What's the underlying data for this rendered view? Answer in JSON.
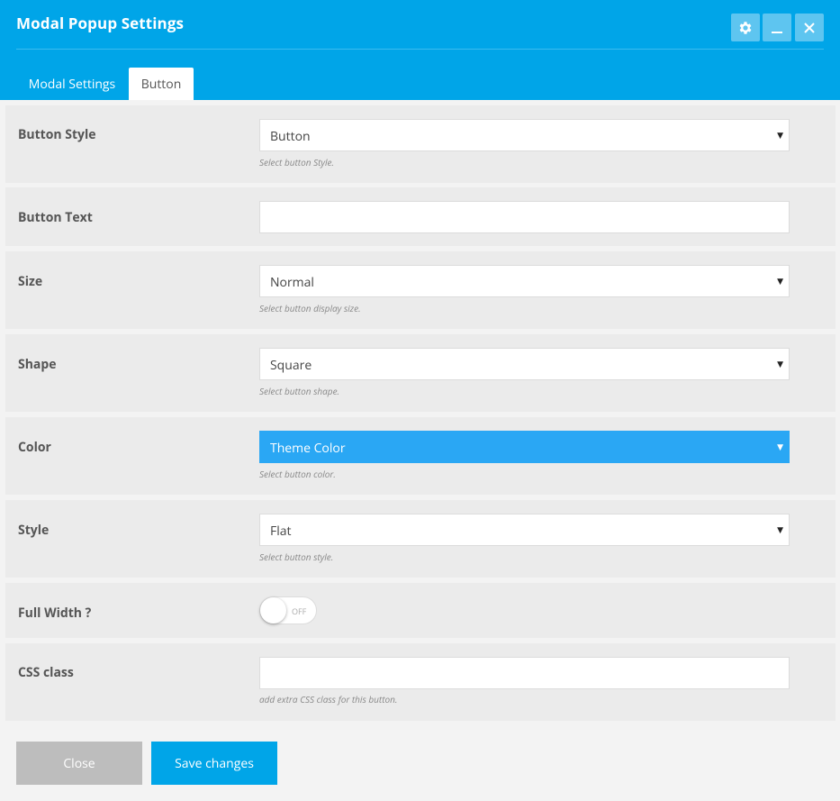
{
  "window": {
    "title": "Modal Popup Settings",
    "icons": [
      "gear-icon",
      "minimize-icon",
      "close-icon"
    ]
  },
  "tabs": [
    {
      "label": "Modal Settings",
      "active": false
    },
    {
      "label": "Button",
      "active": true
    }
  ],
  "form": {
    "button_style": {
      "label": "Button Style",
      "value": "Button",
      "help": "Select button Style."
    },
    "button_text": {
      "label": "Button Text",
      "value": ""
    },
    "size": {
      "label": "Size",
      "value": "Normal",
      "help": "Select button display size."
    },
    "shape": {
      "label": "Shape",
      "value": "Square",
      "help": "Select button shape."
    },
    "color": {
      "label": "Color",
      "value": "Theme Color",
      "help": "Select button color.",
      "swatch": "#2aa7f4"
    },
    "style": {
      "label": "Style",
      "value": "Flat",
      "help": "Select button style."
    },
    "full_width": {
      "label": "Full Width ?",
      "state": "OFF"
    },
    "css_class": {
      "label": "CSS class",
      "value": "",
      "help": "add extra CSS class for this button."
    }
  },
  "footer": {
    "close_label": "Close",
    "save_label": "Save changes"
  },
  "colors": {
    "header": "#00a5e8",
    "save_button": "#00a5e8",
    "close_button": "#bdbdbd"
  }
}
